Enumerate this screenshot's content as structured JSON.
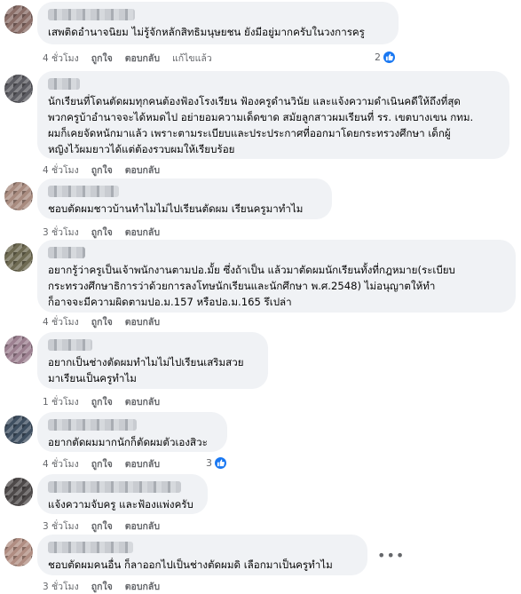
{
  "accent_color": "#1877f2",
  "comments": [
    {
      "text": "เสพติดอำนาจนิยม ไม่รู้จักหลักสิทธิมนุษยชน ยังมีอยู่มากครับในวงการครู",
      "time": "4 ชั่วโมง",
      "like": "ถูกใจ",
      "reply": "ตอบกลับ",
      "edited": "แก้ไขแล้ว",
      "reaction_count": "2",
      "reaction_icon": "like-icon"
    },
    {
      "text": "นักเรียนที่โดนตัดผมทุกคนต้องฟ้องโรงเรียน ฟ้องครูดำนวินัย และแจ้งความดำเนินคดีให้ถึงที่สุด\nพวกครูบ้าอำนาจจะได้หมดไป อย่ายอมความเด็ดขาด สมัยลูกสาวผมเรียนที่ รร. เขตบางเขน กทม.\nผมก็เคยจัดหนักมาแล้ว เพราะตามระเบียบและประประกาศที่ออกมาโดยกระทรวงศึกษา เด็กผู้\nหญิงไว้ผมยาวได้แต่ต้องรวบผมให้เรียบร้อย",
      "time": "4 ชั่วโมง",
      "like": "ถูกใจ",
      "reply": "ตอบกลับ"
    },
    {
      "text": "ชอบตัดผมชาวบ้านทำไมไม่ไปเรียนตัดผม เรียนครูมาทำไม",
      "time": "3 ชั่วโมง",
      "like": "ถูกใจ",
      "reply": "ตอบกลับ"
    },
    {
      "text": "อยากรู้ว่าครูเป็นเจ้าพนักงานตามปอ.มั้ย ซึ่งถ้าเป็น แล้วมาตัดผมนักเรียนทั้งที่กฎหมาย(ระเบียบ\nกระทรวงศึกษาธิการว่าด้วยการลงโทษนักเรียนและนักศึกษา พ.ศ.2548) ไม่อนุญาตให้ทำ\nก็อาจจะมีความผิดตามปอ.ม.157 หรือปอ.ม.165 รึเปล่า",
      "time": "4 ชั่วโมง",
      "like": "ถูกใจ",
      "reply": "ตอบกลับ"
    },
    {
      "text": "อยากเป็นช่างตัดผมทำไมไม่ไปเรียนเสริมสวย\nมาเรียนเป็นครูทำไม",
      "time": "1 ชั่วโมง",
      "like": "ถูกใจ",
      "reply": "ตอบกลับ"
    },
    {
      "text": "อยากตัดผมมากนักก็ตัดผมตัวเองสิวะ",
      "time": "4 ชั่วโมง",
      "like": "ถูกใจ",
      "reply": "ตอบกลับ",
      "reaction_count": "3",
      "reaction_icon": "like-icon"
    },
    {
      "text": "แจ้งความจับครู และฟ้องแพ่งครับ",
      "time": "3 ชั่วโมง",
      "like": "ถูกใจ",
      "reply": "ตอบกลับ"
    },
    {
      "text": "ชอบตัดผมคนอื่น ก็ลาออกไปเป็นช่างตัดผมดิ เลือกมาเป็นครูทำไม",
      "time": "3 ชั่วโมง",
      "like": "ถูกใจ",
      "reply": "ตอบกลับ",
      "more_icon": "more-options-icon"
    }
  ]
}
